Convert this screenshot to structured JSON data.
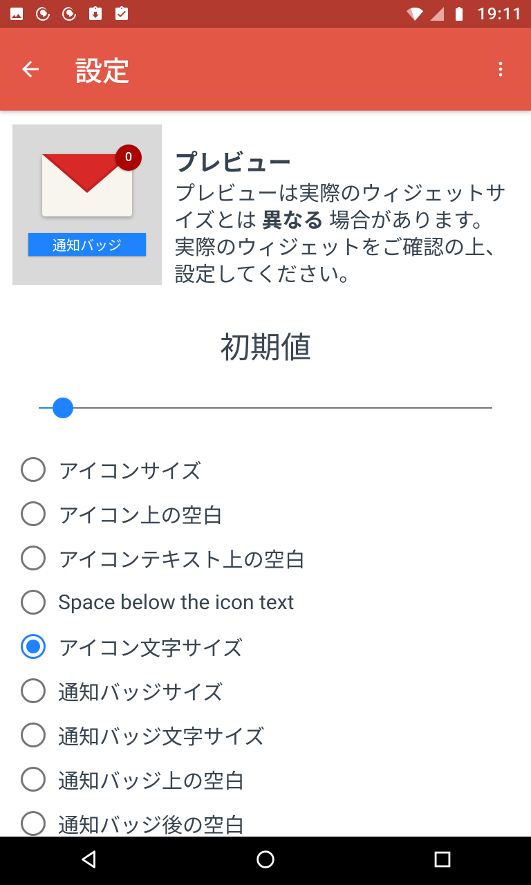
{
  "status": {
    "time": "19:11"
  },
  "appbar": {
    "title": "設定"
  },
  "preview": {
    "badge_count": "0",
    "strip_label": "通知バッジ",
    "title": "プレビュー",
    "desc_before": " プレビューは実際のウィジェットサイズとは ",
    "desc_bold": "異なる",
    "desc_after": " 場合があります。 実際のウィジェットをご確認の上、設定してください。"
  },
  "slider": {
    "section_title": "初期値"
  },
  "options": [
    {
      "label": "アイコンサイズ",
      "checked": false
    },
    {
      "label": "アイコン上の空白",
      "checked": false
    },
    {
      "label": "アイコンテキスト上の空白",
      "checked": false
    },
    {
      "label": "Space below the icon text",
      "checked": false
    },
    {
      "label": "アイコン文字サイズ",
      "checked": true
    },
    {
      "label": "通知バッジサイズ",
      "checked": false
    },
    {
      "label": "通知バッジ文字サイズ",
      "checked": false
    },
    {
      "label": "通知バッジ上の空白",
      "checked": false
    },
    {
      "label": "通知バッジ後の空白",
      "checked": false
    }
  ]
}
